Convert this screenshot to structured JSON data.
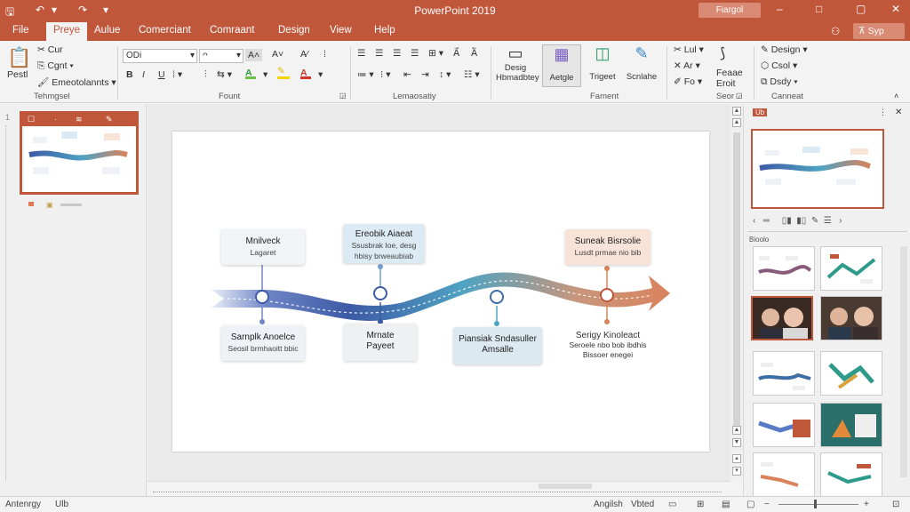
{
  "window": {
    "title": "PowerPoint 2019",
    "search_text": "Fiargol",
    "controls": {
      "minimize": "–",
      "restore": "□",
      "close": "✕"
    }
  },
  "tabs": [
    "File",
    "Preye",
    "Aulue",
    "Comerciant",
    "Comraant",
    "Design",
    "View",
    "Help"
  ],
  "active_tab": "Preye",
  "share_label": "Syp",
  "ribbon": {
    "clipboard": {
      "paste": "Pestl",
      "cut": "Cur",
      "copy": "Cgnt",
      "format": "Emeotolannts",
      "label": "Tehmgsel"
    },
    "font": {
      "name": "ODi",
      "size": "ᴖ",
      "bold": "B",
      "italic": "I",
      "underline": "U",
      "label": "Fount"
    },
    "paragraph": {
      "label": "Lemaosatiy"
    },
    "slides": {
      "design": "Desig",
      "design_sub": "Hbmadbtey",
      "b1": "Aetgle",
      "b2": "Trigeet",
      "b3": "Scnlahe",
      "label": "Fament"
    },
    "edit": {
      "r1": "Lul",
      "r2": "Ar",
      "r3": "Fo",
      "b1": "Feaae",
      "b1_sub": "Eroit",
      "label": "Seor"
    },
    "design": {
      "r1": "Design",
      "r2": "Csol",
      "r3": "Dsdy",
      "label": "Canneat"
    }
  },
  "left_pane": {
    "slide_number": "1"
  },
  "slide": {
    "top_boxes": [
      {
        "title": "Mnilveck",
        "sub": "Lagaret"
      },
      {
        "title": "Ereobik Aiaeat",
        "sub": "Ssusbrak Ioe, desg hbisy brweaubiab"
      },
      {
        "title": "Suneak Bisrsolie",
        "sub": "Lusdt prmae nio bib"
      }
    ],
    "bottom_boxes": [
      {
        "title": "Sarnplk Anoelce",
        "sub": "Seosil brmhaoitt bbic"
      },
      {
        "title": "Mrnate",
        "sub": "Payeet"
      },
      {
        "title": "Piansiak Sndasuller",
        "sub": "Amsalle"
      }
    ],
    "bottom_plain": {
      "title": "Serigy Kinoleact",
      "sub": "Seroele nbo bob ibdhis Bissoer enegei"
    }
  },
  "right_pane": {
    "header": "Ub",
    "section": "Bioolo"
  },
  "status_bar": {
    "left": "Antenrgy",
    "left2": "Ulb",
    "r1": "Angilsh",
    "r2": "Vbted"
  },
  "colors": {
    "accent": "#c0573b",
    "flow_start": "#3d5aa6",
    "flow_mid": "#4fa3c2",
    "flow_end": "#d9825c"
  }
}
